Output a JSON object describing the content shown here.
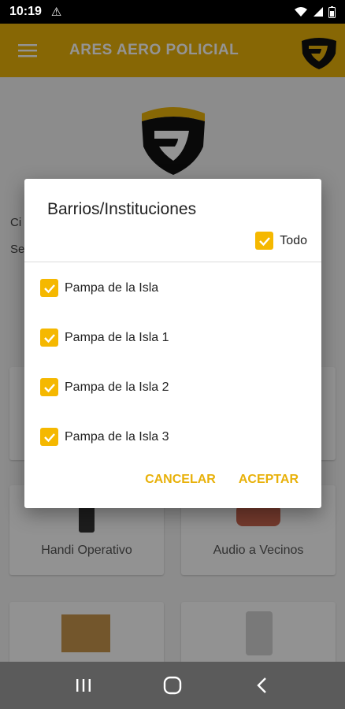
{
  "status_bar": {
    "time": "10:19"
  },
  "app_bar": {
    "title": "ARES AERO POLICIAL"
  },
  "background": {
    "partial_labels": [
      "Ci",
      "Se"
    ],
    "cards": [
      {
        "label": "Handi Operativo"
      },
      {
        "label": "Audio a Vecinos"
      }
    ]
  },
  "dialog": {
    "title": "Barrios/Instituciones",
    "select_all": {
      "label": "Todo",
      "checked": true
    },
    "options": [
      {
        "label": "Pampa de la Isla",
        "checked": true
      },
      {
        "label": "Pampa de la Isla 1",
        "checked": true
      },
      {
        "label": "Pampa de la Isla 2",
        "checked": true
      },
      {
        "label": "Pampa de la Isla 3",
        "checked": true
      }
    ],
    "cancel_label": "CANCELAR",
    "accept_label": "ACEPTAR"
  },
  "colors": {
    "accent": "#e8b10a",
    "checkbox": "#f5b800"
  },
  "icons": {
    "menu": "hamburger-icon",
    "logo": "shield-logo",
    "check": "check-icon",
    "nav_recent": "recent-apps-icon",
    "nav_home": "home-icon",
    "nav_back": "back-icon"
  }
}
